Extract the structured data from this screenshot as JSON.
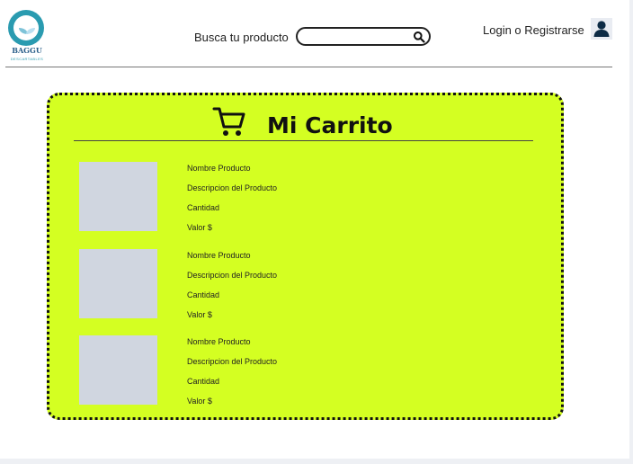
{
  "header": {
    "logo": {
      "brand": "BAGGU",
      "tagline": "DESCARTABLES"
    },
    "search": {
      "label": "Busca tu producto",
      "value": "",
      "placeholder": ""
    },
    "login_label": "Login o Registrarse"
  },
  "cart": {
    "title": "Mi Carrito",
    "items": [
      {
        "name": "Nombre Producto",
        "description": "Descripcion del Producto",
        "quantity": "Cantidad",
        "price": "Valor $"
      },
      {
        "name": "Nombre Producto",
        "description": "Descripcion del Producto",
        "quantity": "Cantidad",
        "price": "Valor $"
      },
      {
        "name": "Nombre Producto",
        "description": "Descripcion del Producto",
        "quantity": "Cantidad",
        "price": "Valor $"
      }
    ]
  },
  "colors": {
    "panel": "#d4ff22",
    "thumb": "#d0d6e0",
    "user_icon": "#0d2b45",
    "logo": "#2a9bb0"
  },
  "icons": [
    "search-icon",
    "user-icon",
    "cart-icon"
  ]
}
